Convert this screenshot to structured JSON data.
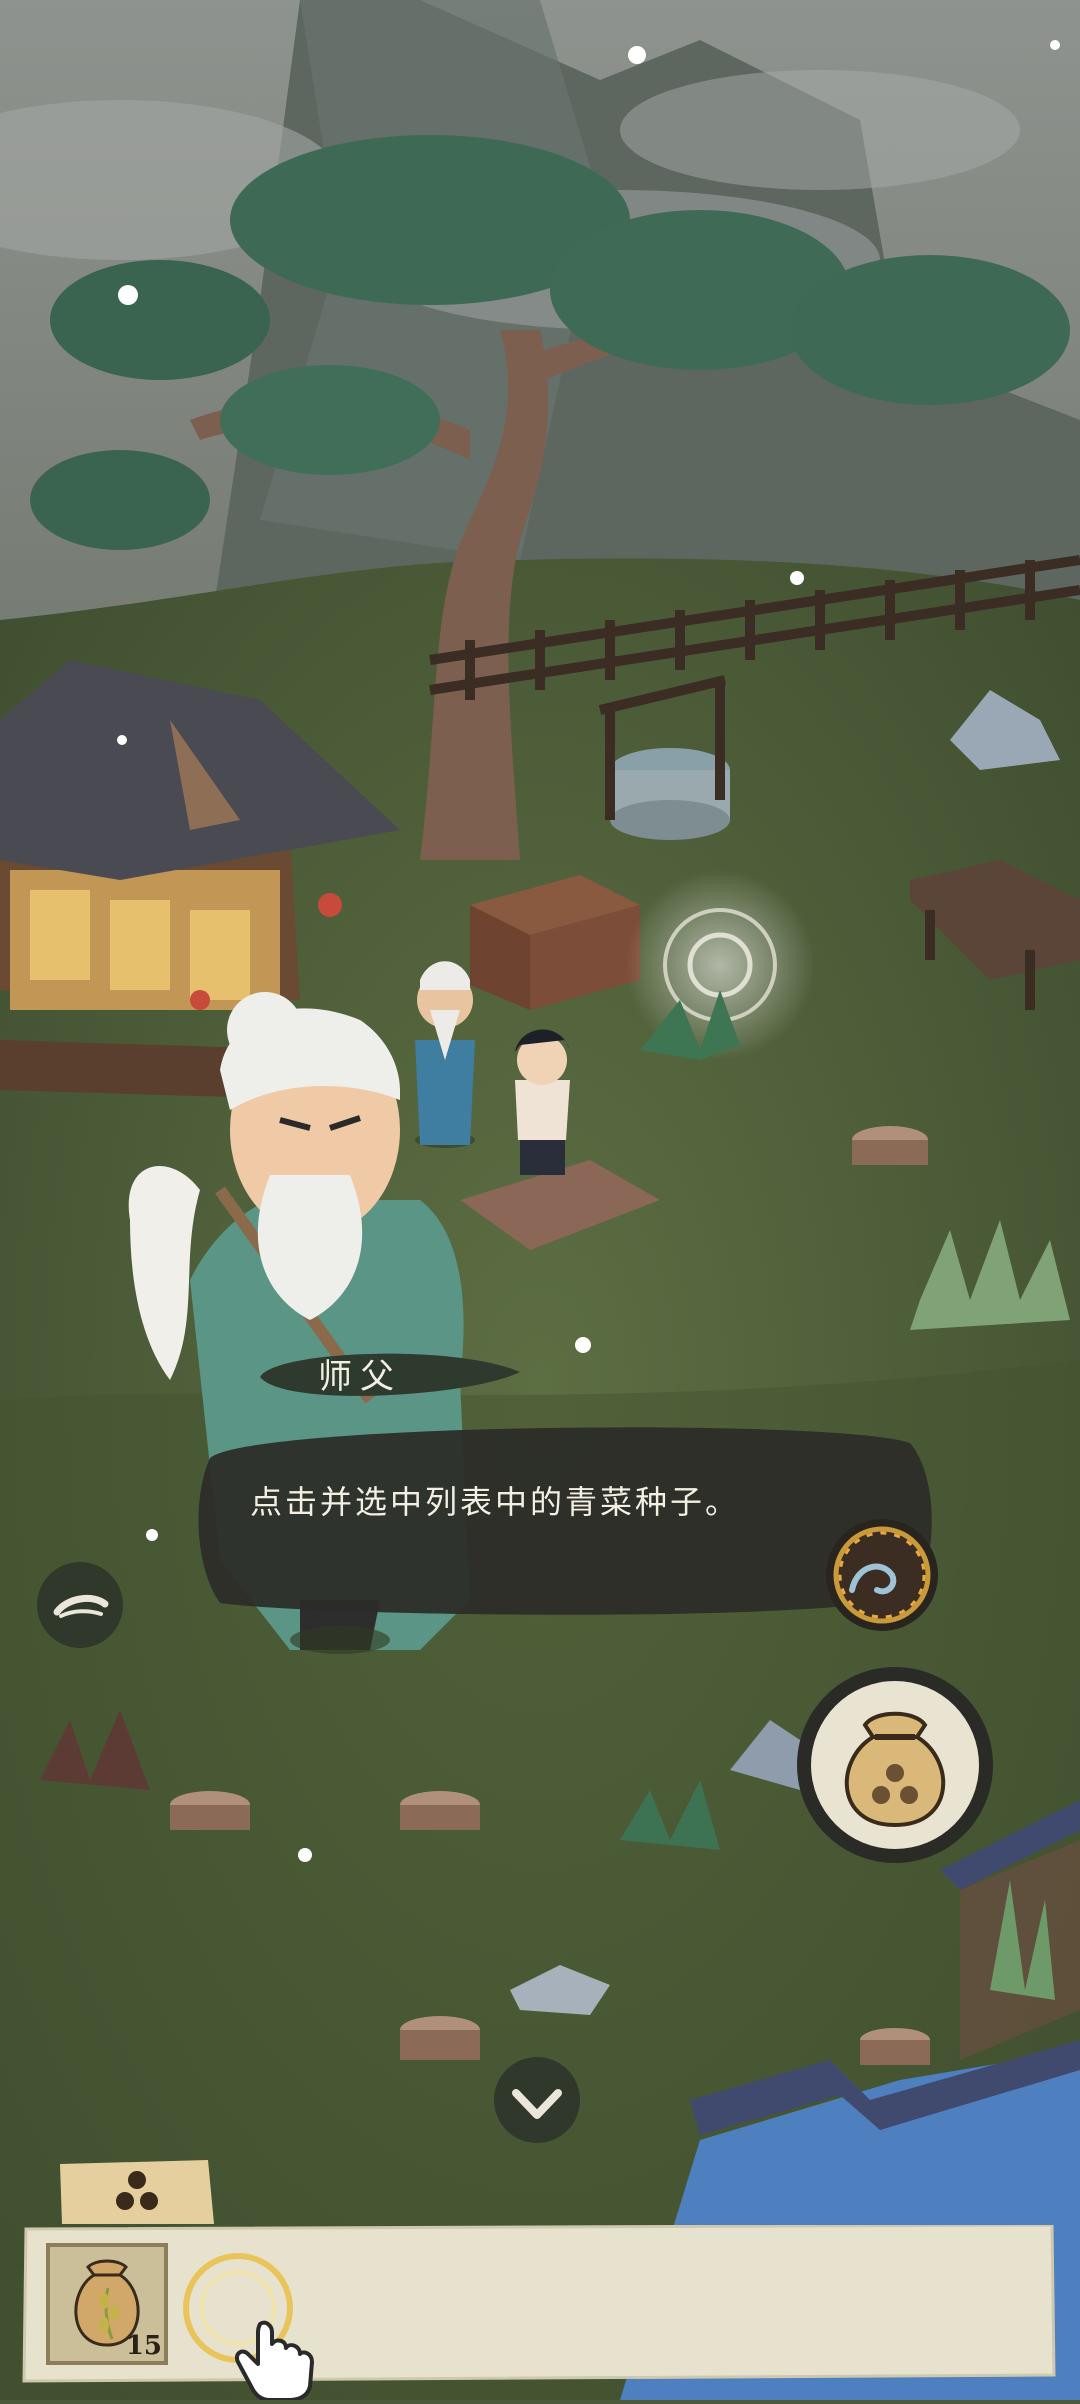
{
  "dialogue": {
    "speaker": "师父",
    "text": "点击并选中列表中的青菜种子。"
  },
  "inventory": {
    "items": [
      {
        "name": "青菜种子",
        "icon": "seed-bag-icon",
        "count": "15"
      }
    ]
  },
  "icons": {
    "hide_ui": "eye-closed-icon",
    "skip": "swirl-skip-icon",
    "seed_bag": "seed-bag-icon",
    "collapse": "chevron-down-icon",
    "tab": "seed-triangle-icon",
    "tap_hint": "tap-hand-icon"
  },
  "colors": {
    "dialog_bg": "#2c2d27",
    "ink_text": "#f3efe3",
    "paper": "#e7e2ce",
    "bag": "#d9b87a",
    "accent_gold": "#e8c45a"
  }
}
